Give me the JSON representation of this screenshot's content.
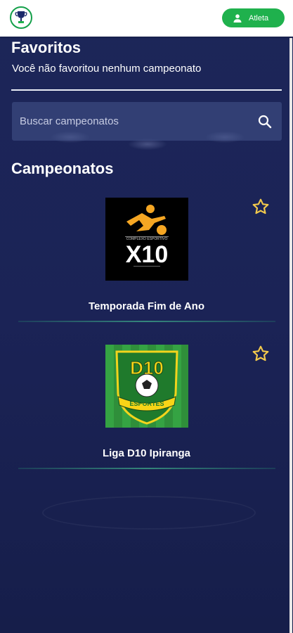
{
  "header": {
    "athlete_label": "Atleta"
  },
  "favorites": {
    "title": "Favoritos",
    "empty_message": "Você não favoritou nenhum campeonato"
  },
  "search": {
    "placeholder": "Buscar campeonatos"
  },
  "championships": {
    "title": "Campeonatos",
    "items": [
      {
        "name": "Temporada Fim de Ano",
        "logo_text": "X10",
        "logo_subtext": "COMPLEXO ESPORTIVO"
      },
      {
        "name": "Liga D10 Ipiranga",
        "logo_text": "D10",
        "logo_subtext": "ESPORTES"
      }
    ]
  },
  "colors": {
    "background": "#1a2454",
    "accent_green": "#1fb14d",
    "star_yellow": "#f2c94c"
  }
}
